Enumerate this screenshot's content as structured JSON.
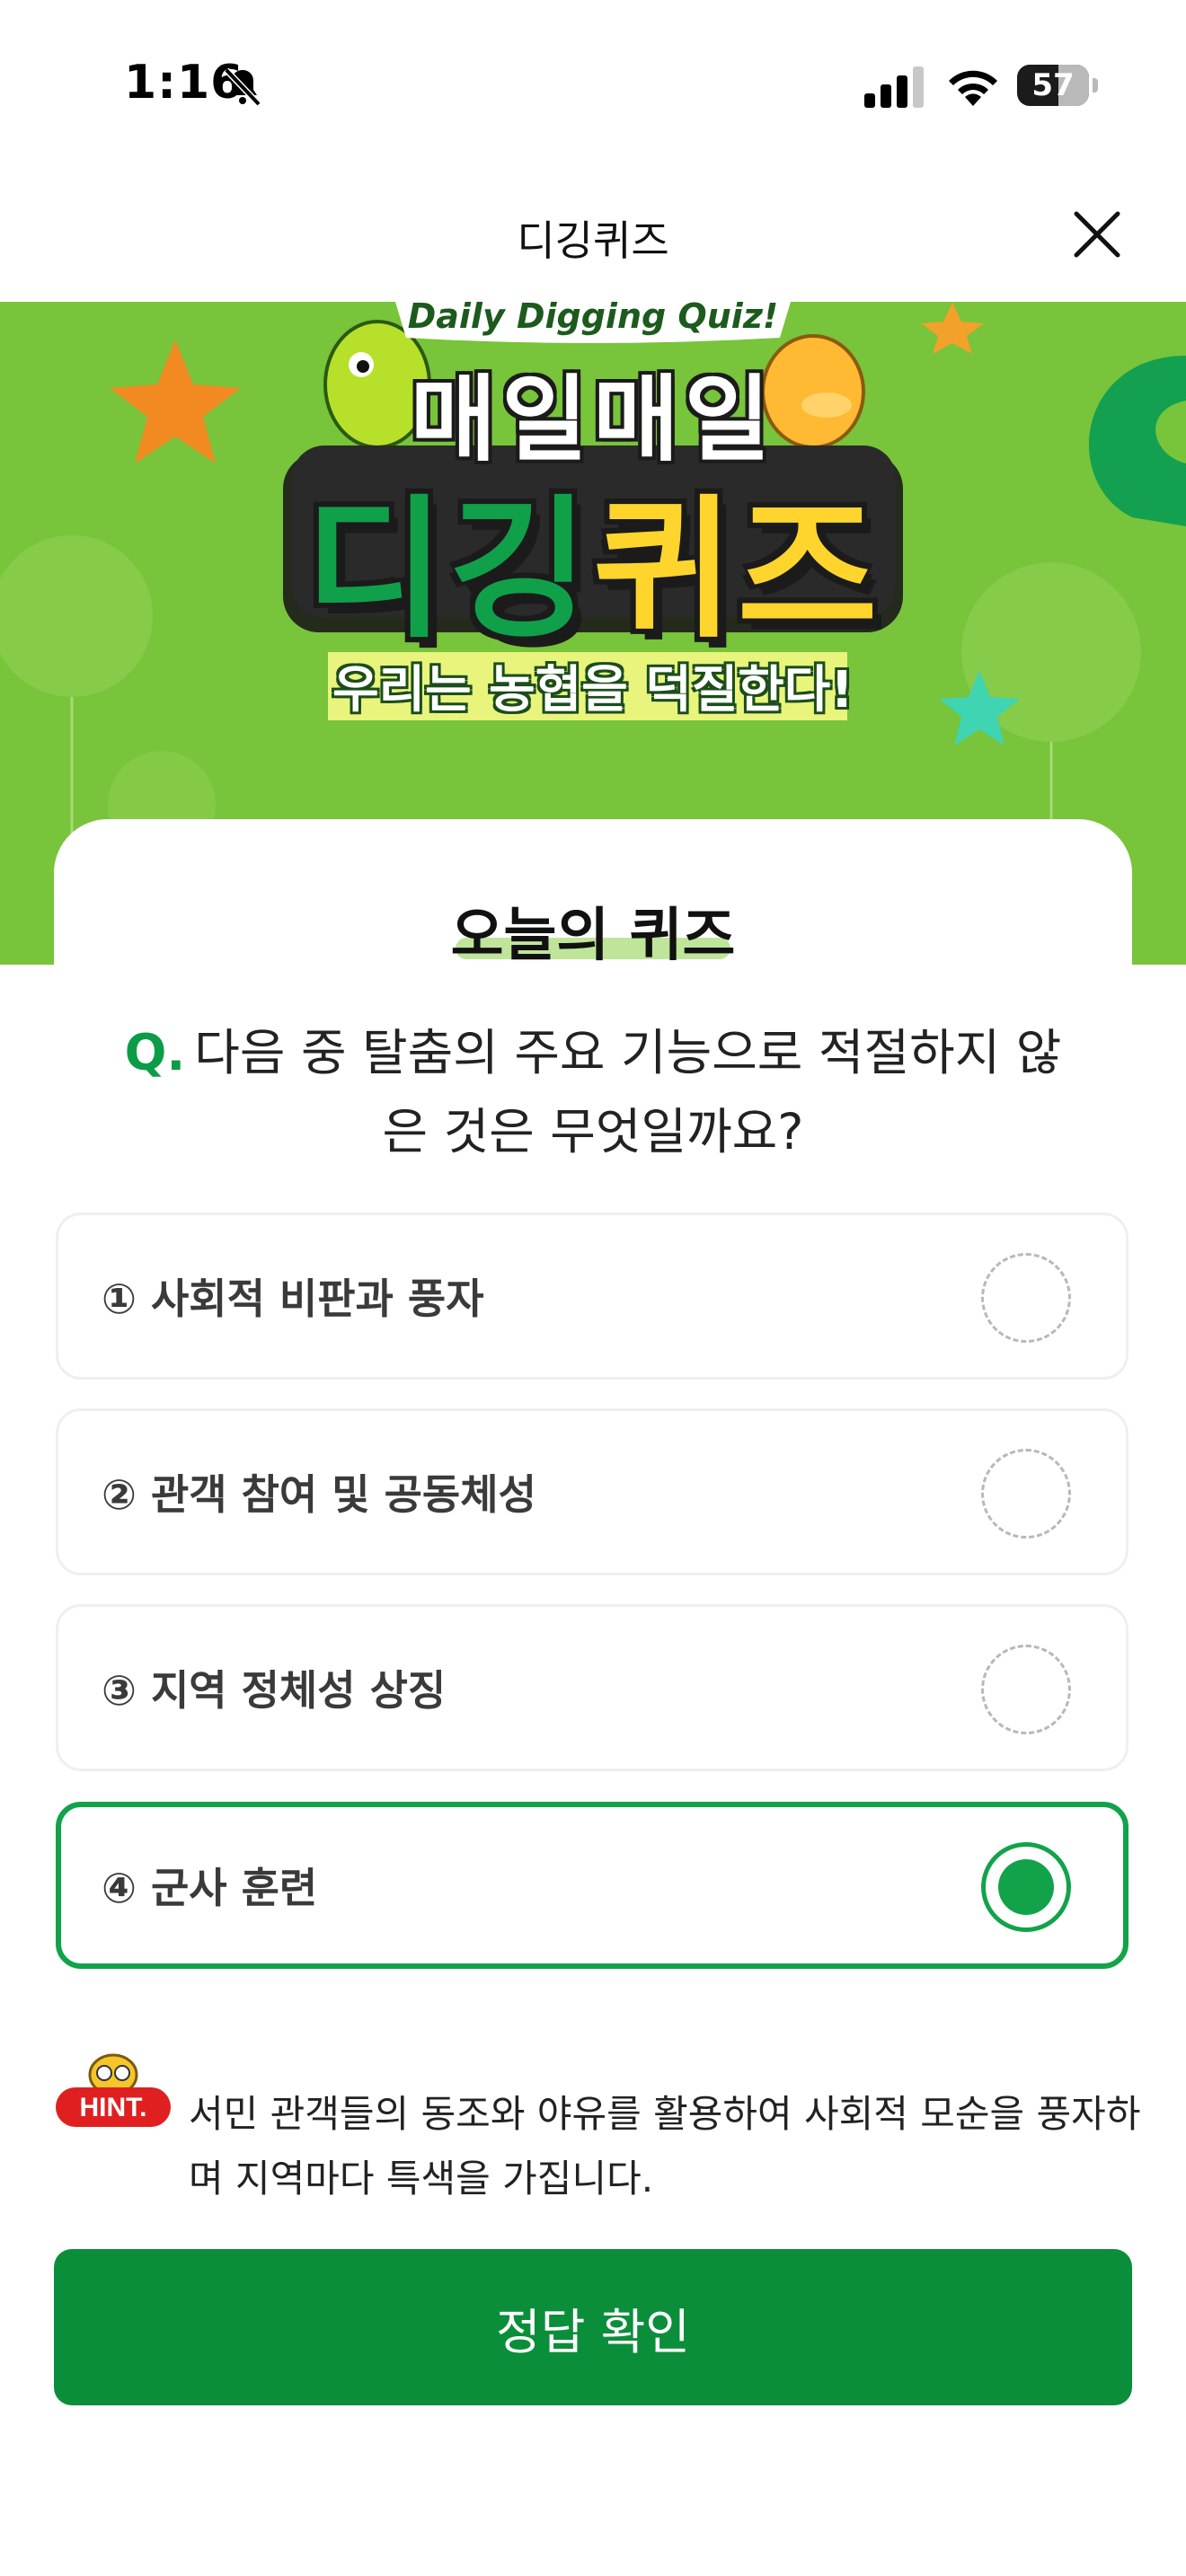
{
  "status_bar": {
    "time": "1:16",
    "battery": "57"
  },
  "header": {
    "title": "디깅퀴즈"
  },
  "banner": {
    "english_title": "Daily Digging Quiz!",
    "line1": "매일매일",
    "line2_a": "디깅",
    "line2_b": "퀴즈",
    "slogan": "우리는 농협을 덕질한다!"
  },
  "quiz": {
    "section_title": "오늘의 퀴즈",
    "question_prefix": "Q.",
    "question": "다음 중 탈춤의 주요 기능으로 적절하지 않은 것은 무엇일까요?",
    "options": [
      {
        "label": "① 사회적 비판과 풍자",
        "selected": false
      },
      {
        "label": "② 관객 참여 및 공동체성",
        "selected": false
      },
      {
        "label": "③ 지역 정체성 상징",
        "selected": false
      },
      {
        "label": "④ 군사 훈련",
        "selected": true
      }
    ],
    "hint_label": "HINT.",
    "hint": "서민 관객들의 동조와 야유를 활용하여 사회적 모순을 풍자하며 지역마다 특색을 가집니다.",
    "submit_label": "정답 확인"
  },
  "colors": {
    "accent": "#12a34a",
    "button": "#0b8e3a",
    "banner_bg": "#78c43a",
    "hint_badge": "#e02020"
  }
}
